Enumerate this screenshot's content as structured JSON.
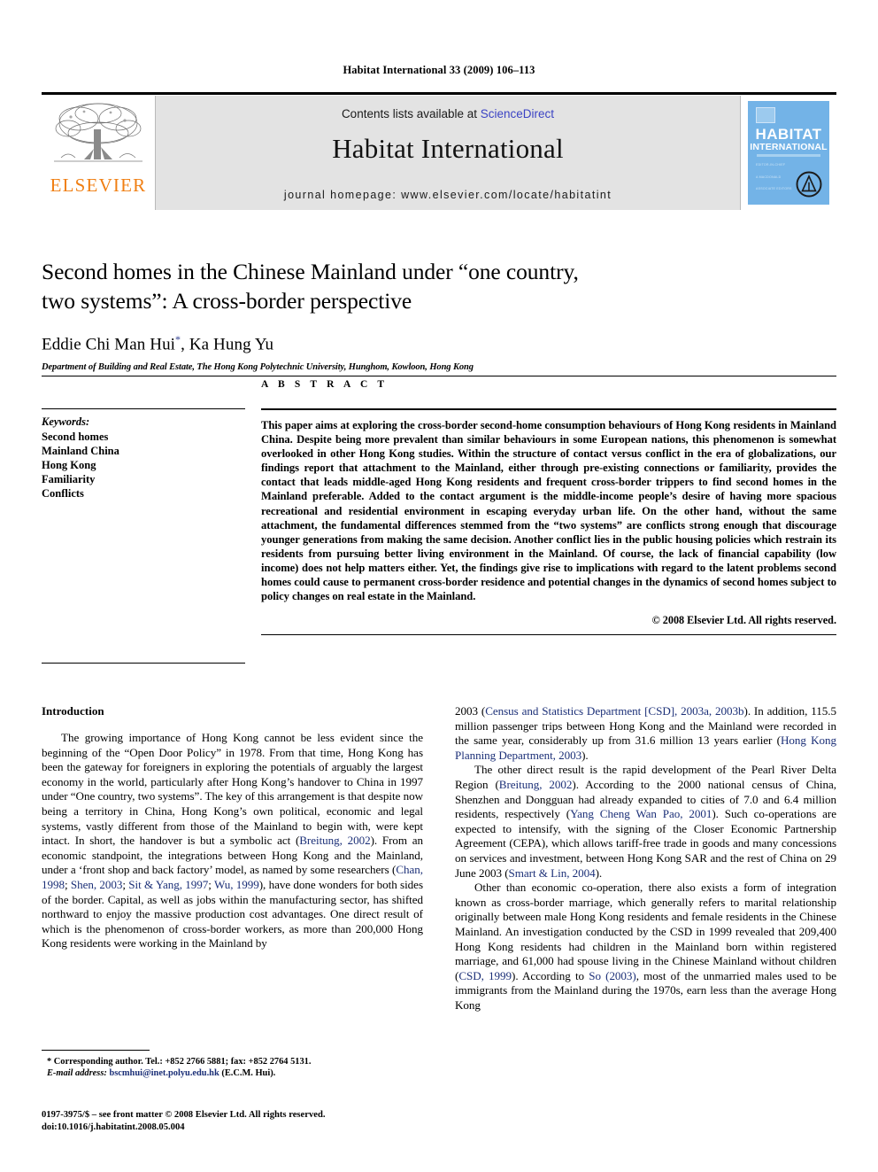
{
  "running_head": "Habitat International 33 (2009) 106–113",
  "masthead": {
    "publisher_wordmark": "ELSEVIER",
    "contents_prefix": "Contents lists available at ",
    "sciencedirect": "ScienceDirect",
    "journal_name": "Habitat International",
    "homepage": "journal homepage: www.elsevier.com/locate/habitatint",
    "cover": {
      "title_line1": "HABITAT",
      "title_line2": "INTERNATIONAL",
      "meta_line1": "EDITOR-IN-CHIEF",
      "meta_line2": "A MACDONALD",
      "meta_line3": "ASSOCIATE EDITORS"
    },
    "colors": {
      "banner_bg": "#e3e3e3",
      "elsevier_orange": "#F07F13",
      "cover_blue": "#73b3e7",
      "link_blue": "#3b43c4"
    }
  },
  "article": {
    "title_line1": "Second homes in the Chinese Mainland under “one country,",
    "title_line2": "two systems”: A cross-border perspective",
    "authors": "Eddie Chi Man Hui",
    "authors_tail": ", Ka Hung Yu",
    "corresponding_mark": "*",
    "affiliation": "Department of Building and Real Estate, The Hong Kong Polytechnic University, Hunghom, Kowloon, Hong Kong"
  },
  "keywords": {
    "heading": "Keywords:",
    "items": [
      "Second homes",
      "Mainland China",
      "Hong Kong",
      "Familiarity",
      "Conflicts"
    ]
  },
  "abstract": {
    "heading": "A B S T R A C T",
    "text": "This paper aims at exploring the cross-border second-home consumption behaviours of Hong Kong residents in Mainland China. Despite being more prevalent than similar behaviours in some European nations, this phenomenon is somewhat overlooked in other Hong Kong studies. Within the structure of contact versus conflict in the era of globalizations, our findings report that attachment to the Mainland, either through pre-existing connections or familiarity, provides the contact that leads middle-aged Hong Kong residents and frequent cross-border trippers to find second homes in the Mainland preferable. Added to the contact argument is the middle-income people’s desire of having more spacious recreational and residential environment in escaping everyday urban life. On the other hand, without the same attachment, the fundamental differences stemmed from the “two systems” are conflicts strong enough that discourage younger generations from making the same decision. Another conflict lies in the public housing policies which restrain its residents from pursuing better living environment in the Mainland. Of course, the lack of financial capability (low income) does not help matters either. Yet, the findings give rise to implications with regard to the latent problems second homes could cause to permanent cross-border residence and potential changes in the dynamics of second homes subject to policy changes on real estate in the Mainland.",
    "copyright": "© 2008 Elsevier Ltd. All rights reserved."
  },
  "body": {
    "section_heading": "Introduction",
    "left_paragraphs": [
      {
        "runs": [
          {
            "t": "The growing importance of Hong Kong cannot be less evident since the beginning of the “Open Door Policy” in 1978. From that time, Hong Kong has been the gateway for foreigners in exploring the potentials of arguably the largest economy in the world, particularly after Hong Kong’s handover to China in 1997 under “One country, two systems”. The key of this arrangement is that despite now being a territory in China, Hong Kong’s own political, economic and legal systems, vastly different from those of the Mainland to begin with, were kept intact. In short, the handover is but a symbolic act ("
          },
          {
            "t": "Breitung, 2002",
            "cite": true
          },
          {
            "t": "). From an economic standpoint, the integrations between Hong Kong and the Mainland, under a ‘front shop and back factory’ model, as named by some researchers ("
          },
          {
            "t": "Chan, 1998",
            "cite": true
          },
          {
            "t": "; "
          },
          {
            "t": "Shen, 2003",
            "cite": true
          },
          {
            "t": "; "
          },
          {
            "t": "Sit & Yang, 1997",
            "cite": true
          },
          {
            "t": "; "
          },
          {
            "t": "Wu, 1999",
            "cite": true
          },
          {
            "t": "), have done wonders for both sides of the border. Capital, as well as jobs within the manufacturing sector, has shifted northward to enjoy the massive production cost advantages. One direct result of which is the phenomenon of cross-border workers, as more than 200,000 Hong Kong residents were working in the Mainland by"
          }
        ],
        "indent": true
      }
    ],
    "right_paragraphs": [
      {
        "runs": [
          {
            "t": "2003 ("
          },
          {
            "t": "Census and Statistics Department [CSD], 2003a, 2003b",
            "cite": true
          },
          {
            "t": "). In addition, 115.5 million passenger trips between Hong Kong and the Mainland were recorded in the same year, considerably up from 31.6 million 13 years earlier ("
          },
          {
            "t": "Hong Kong Planning Department, 2003",
            "cite": true
          },
          {
            "t": ")."
          }
        ],
        "indent": false
      },
      {
        "runs": [
          {
            "t": "The other direct result is the rapid development of the Pearl River Delta Region ("
          },
          {
            "t": "Breitung, 2002",
            "cite": true
          },
          {
            "t": "). According to the 2000 national census of China, Shenzhen and Dongguan had already expanded to cities of 7.0 and 6.4 million residents, respectively ("
          },
          {
            "t": "Yang Cheng Wan Pao, 2001",
            "cite": true
          },
          {
            "t": "). Such co-operations are expected to intensify, with the signing of the Closer Economic Partnership Agreement (CEPA), which allows tariff-free trade in goods and many concessions on services and investment, between Hong Kong SAR and the rest of China on 29 June 2003 ("
          },
          {
            "t": "Smart & Lin, 2004",
            "cite": true
          },
          {
            "t": ")."
          }
        ],
        "indent": true
      },
      {
        "runs": [
          {
            "t": "Other than economic co-operation, there also exists a form of integration known as cross-border marriage, which generally refers to marital relationship originally between male Hong Kong residents and female residents in the Chinese Mainland. An investigation conducted by the CSD in 1999 revealed that 209,400 Hong Kong residents had children in the Mainland born within registered marriage, and 61,000 had spouse living in the Chinese Mainland without children ("
          },
          {
            "t": "CSD, 1999",
            "cite": true
          },
          {
            "t": "). According to "
          },
          {
            "t": "So (2003)",
            "cite": true
          },
          {
            "t": ", most of the unmarried males used to be immigrants from the Mainland during the 1970s, earn less than the average Hong Kong"
          }
        ],
        "indent": true
      }
    ]
  },
  "footnote": {
    "corresponding": "* Corresponding author. Tel.: +852 2766 5881; fax: +852 2764 5131.",
    "email_label": "E-mail address:",
    "email": "bscmhui@inet.polyu.edu.hk",
    "email_owner": "(E.C.M. Hui).",
    "imprint_line1": "0197-3975/$ – see front matter © 2008 Elsevier Ltd. All rights reserved.",
    "imprint_line2": "doi:10.1016/j.habitatint.2008.05.004"
  }
}
